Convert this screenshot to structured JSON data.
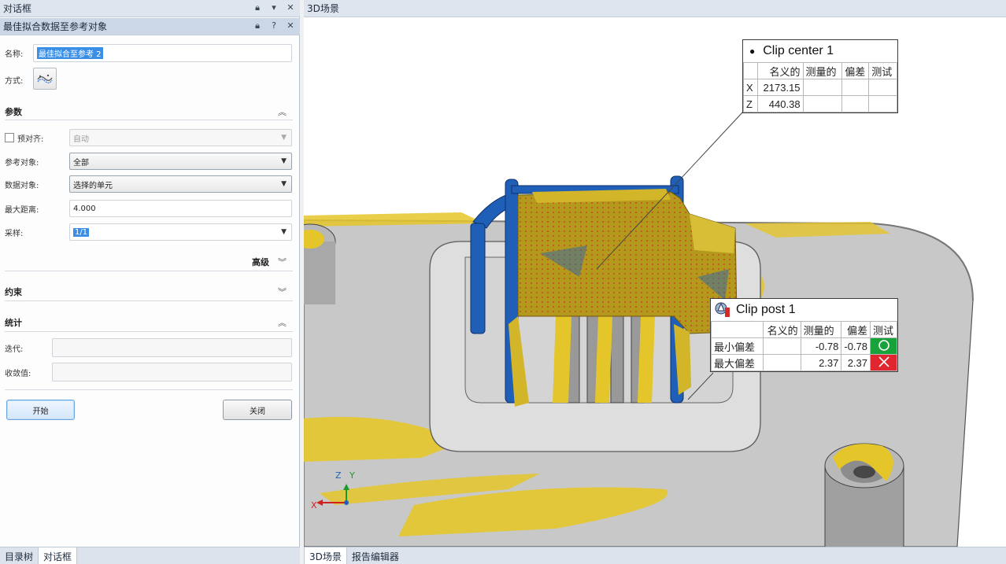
{
  "dialog_pane": {
    "title": "对话框",
    "sub_title": "最佳拟合数据至参考对象",
    "name_label": "名称:",
    "name_value": "最佳拟合至参考 2",
    "method_label": "方式:",
    "parameters_header": "参数",
    "pre_align_label": "预对齐:",
    "pre_align_value": "自动",
    "reference_label": "参考对象:",
    "reference_value": "全部",
    "data_label": "数据对象:",
    "data_value": "选择的单元",
    "max_distance_label": "最大距离:",
    "max_distance_value": "4.000",
    "sampling_label": "采样:",
    "sampling_value": "1/1",
    "advanced_label": "高级",
    "constraints_header": "约束",
    "statistics_header": "统计",
    "iterations_label": "迭代:",
    "convergence_label": "收敛值:",
    "start_button": "开始",
    "close_button": "关闭",
    "bottom_tabs": [
      "目录树",
      "对话框"
    ]
  },
  "scene": {
    "title": "3D场景",
    "bottom_tabs": [
      "3D场景",
      "报告编辑器"
    ],
    "axes": {
      "z": "Z",
      "y": "Y",
      "x": "X"
    },
    "colors": {
      "part_gray": "#c8c8c8",
      "deviation_yellow": "#e5c62a",
      "clip_blue": "#1f5fb8",
      "pass_green": "#17a33a",
      "fail_red": "#e0262f"
    }
  },
  "clip_center": {
    "title": "Clip center 1",
    "columns": [
      "名义的",
      "测量的",
      "偏差",
      "测试"
    ],
    "rows": [
      {
        "axis": "X",
        "nominal": "2173.15",
        "measured": "",
        "deviation": "",
        "test": ""
      },
      {
        "axis": "Z",
        "nominal": "440.38",
        "measured": "",
        "deviation": "",
        "test": ""
      }
    ]
  },
  "clip_post": {
    "title": "Clip post 1",
    "columns": [
      "名义的",
      "测量的",
      "偏差",
      "测试"
    ],
    "rows": [
      {
        "label": "最小偏差",
        "nominal": "",
        "measured": "-0.78",
        "deviation": "-0.78",
        "test": "pass"
      },
      {
        "label": "最大偏差",
        "nominal": "",
        "measured": "2.37",
        "deviation": "2.37",
        "test": "fail"
      }
    ]
  }
}
